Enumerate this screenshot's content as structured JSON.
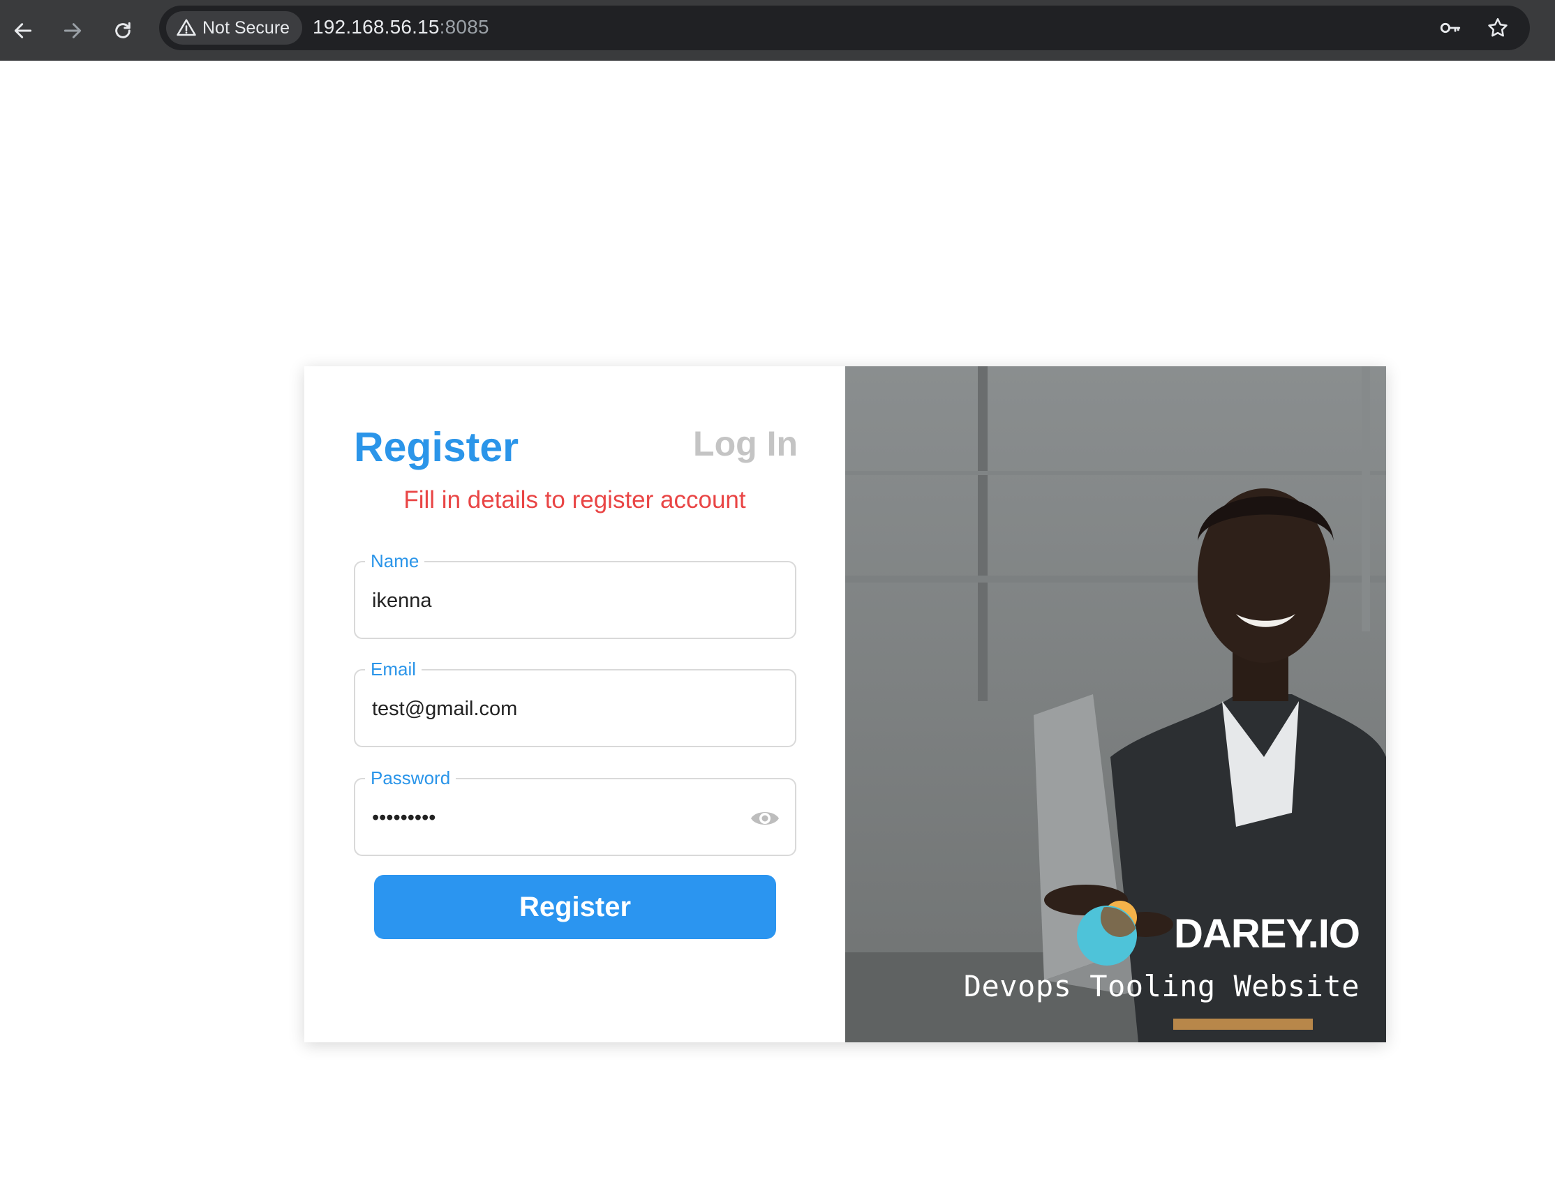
{
  "browser": {
    "security_label": "Not Secure",
    "url_host": "192.168.56.15",
    "url_port": ":8085",
    "icons": [
      "back-arrow-icon",
      "forward-arrow-icon",
      "reload-icon",
      "warning-icon",
      "key-icon",
      "star-icon"
    ]
  },
  "auth": {
    "tab_register": "Register",
    "tab_login": "Log In",
    "subtitle": "Fill in details to register account",
    "fields": {
      "name": {
        "label": "Name",
        "value": "ikenna"
      },
      "email": {
        "label": "Email",
        "value": "test@gmail.com"
      },
      "password": {
        "label": "Password",
        "value": "testpass1"
      }
    },
    "submit_label": "Register"
  },
  "brand": {
    "name": "DAREY.IO",
    "tagline": "Devops Tooling Website"
  },
  "colors": {
    "accent": "#2b95e9",
    "error": "#e94545",
    "tab_inactive": "#c4c4c4",
    "chrome_bg": "#3a3b3d"
  }
}
